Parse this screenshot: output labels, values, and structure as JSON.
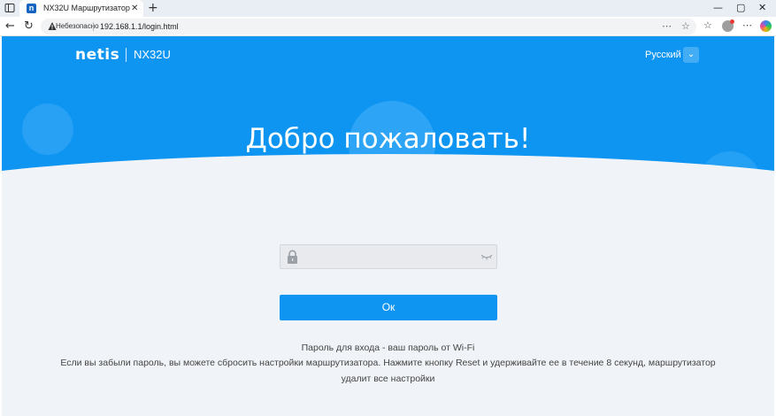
{
  "browser": {
    "tab_title": "NX32U Маршрутизатор",
    "tab_favicon_letter": "n",
    "security_label": "Небезопасно",
    "url": "192.168.1.1/login.html",
    "icons": [
      "sidebar-toggle-icon",
      "close-icon",
      "new-tab-icon",
      "minimize-icon",
      "maximize-icon",
      "window-close-icon",
      "back-icon",
      "reload-icon",
      "warning-icon",
      "more-icon",
      "favorite-star-icon",
      "favorites-icon",
      "profile-icon",
      "more-menu-icon",
      "copilot-icon"
    ]
  },
  "header": {
    "brand": "netis",
    "model": "NX32U",
    "language": "Русский"
  },
  "hero": {
    "welcome": "Добро пожаловать!"
  },
  "login": {
    "password_value": "",
    "ok_label": "Ок"
  },
  "hints": {
    "line1": "Пароль для входа - ваш пароль от Wi-Fi",
    "line2": "Если вы забыли пароль, вы можете сбросить настройки маршрутизатора. Нажмите кнопку Reset и удерживайте ее в течение 8 секунд, маршрутизатор удалит все настройки"
  },
  "colors": {
    "brand_blue": "#0e95f2",
    "page_bg": "#f0f3f7"
  }
}
